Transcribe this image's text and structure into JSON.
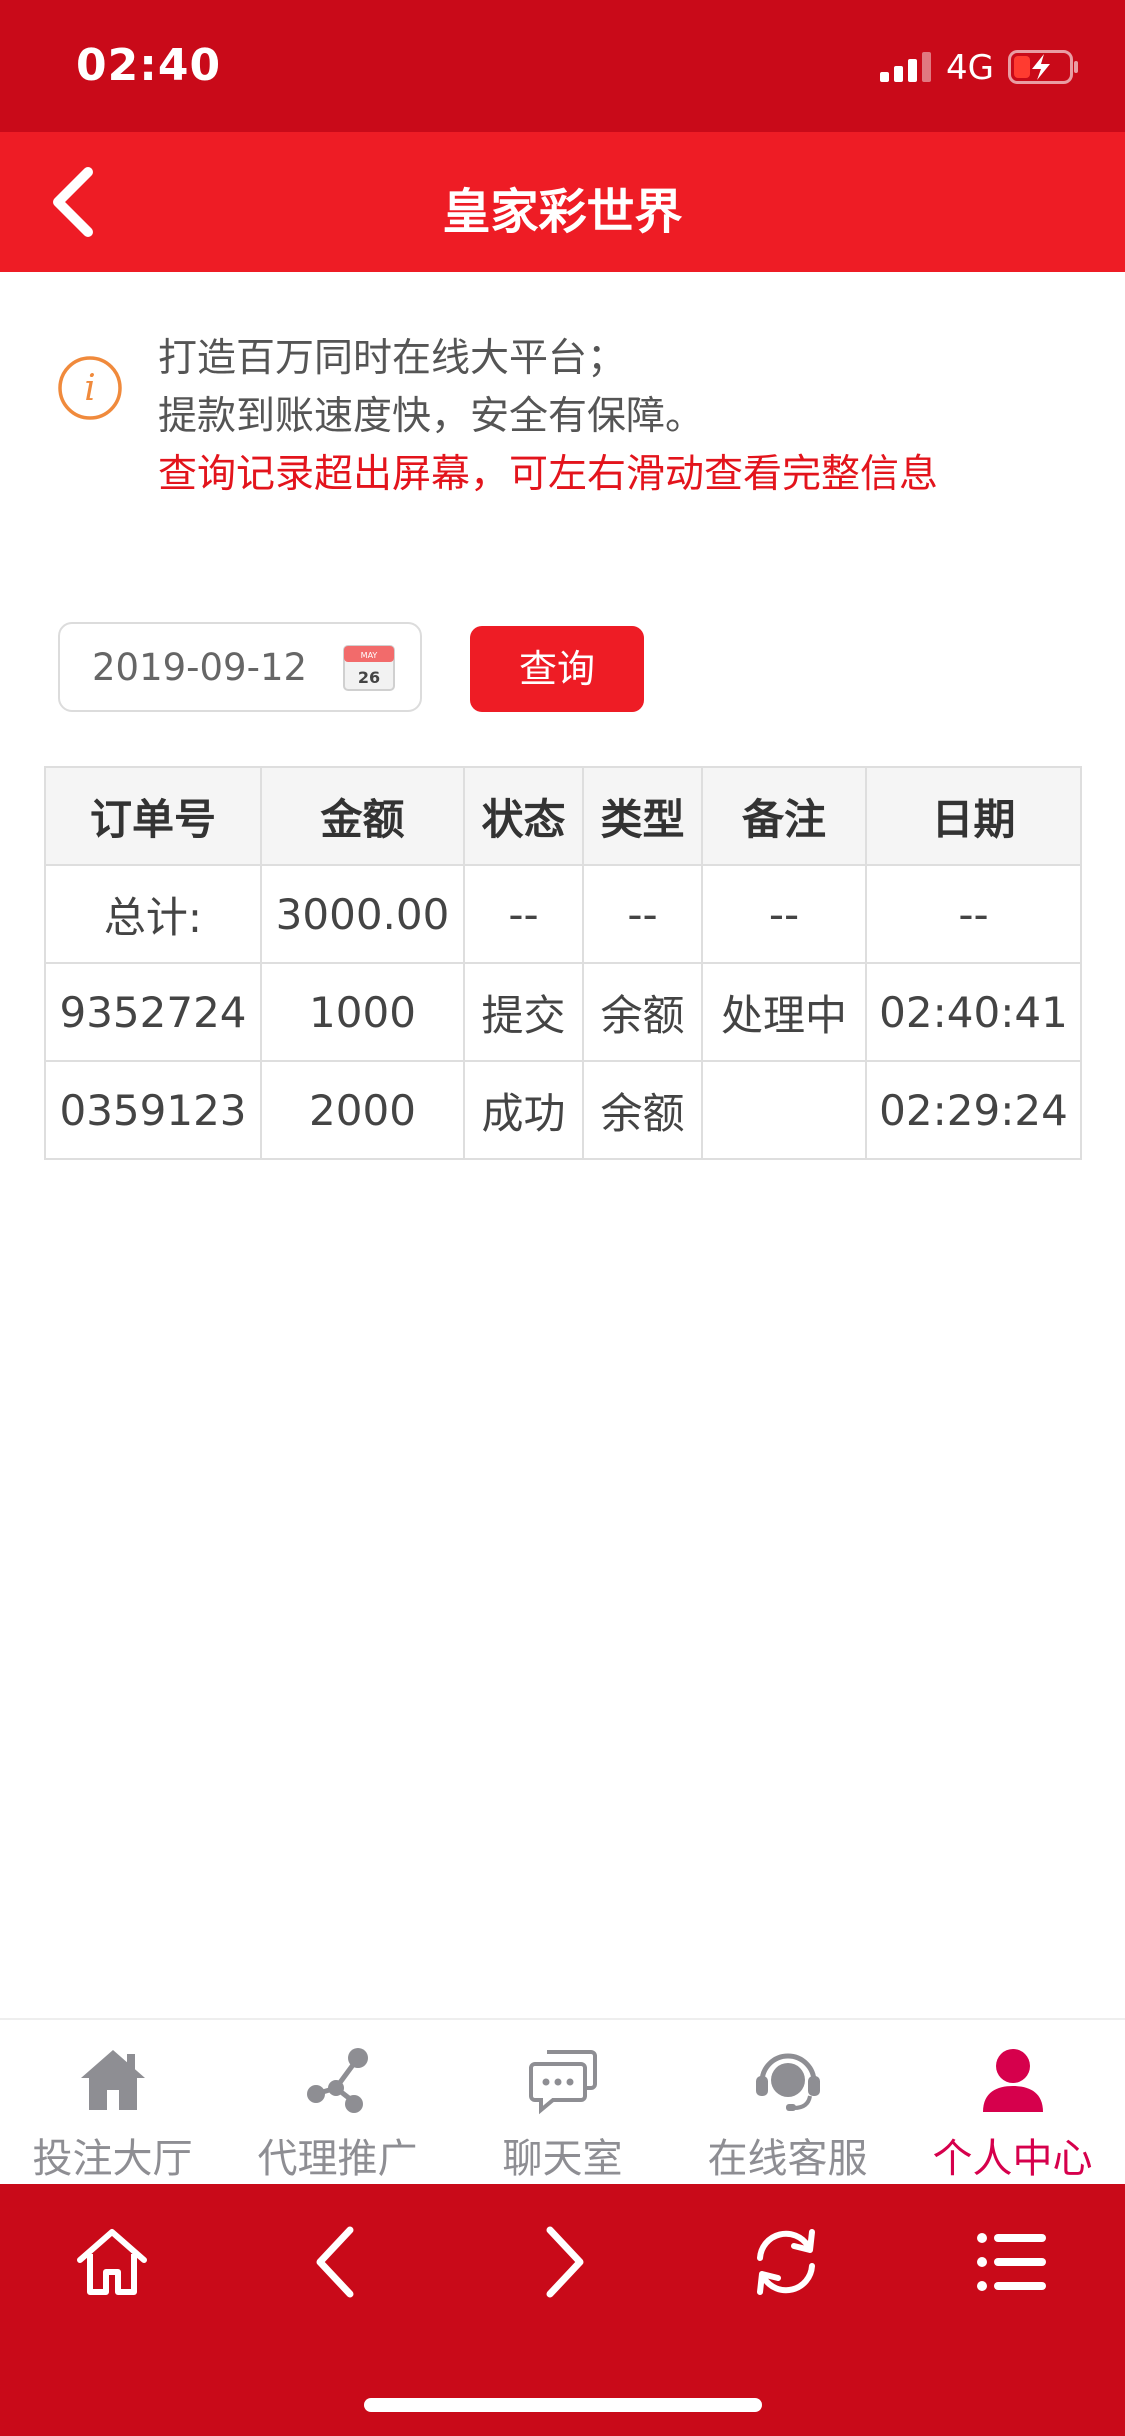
{
  "status_bar": {
    "time": "02:40",
    "network": "4G"
  },
  "header": {
    "title": "皇家彩世界"
  },
  "notice": {
    "lines": [
      "打造百万同时在线大平台；",
      "提款到账速度快，安全有保障。",
      "查询记录超出屏幕，可左右滑动查看完整信息"
    ]
  },
  "query": {
    "date_value": "2019-09-12",
    "calendar_month": "MAY",
    "calendar_day": "26",
    "button_label": "查询"
  },
  "table": {
    "headers": [
      "订单号",
      "金额",
      "状态",
      "类型",
      "备注",
      "日期"
    ],
    "total_row": [
      "总计:",
      "3000.00",
      "--",
      "--",
      "--",
      "--"
    ],
    "rows": [
      [
        "9352724",
        "1000",
        "提交",
        "余额",
        "处理中",
        "02:40:41"
      ],
      [
        "0359123",
        "2000",
        "成功",
        "余额",
        "",
        "02:29:24"
      ]
    ]
  },
  "tabbar": {
    "items": [
      {
        "label": "投注大厅",
        "icon": "home-icon"
      },
      {
        "label": "代理推广",
        "icon": "share-icon"
      },
      {
        "label": "聊天室",
        "icon": "chat-icon"
      },
      {
        "label": "在线客服",
        "icon": "headset-icon"
      },
      {
        "label": "个人中心",
        "icon": "user-icon",
        "active": true
      }
    ]
  },
  "toolbar": {
    "icons": [
      "home-outline-icon",
      "back-arrow-icon",
      "forward-arrow-icon",
      "refresh-icon",
      "menu-icon"
    ]
  },
  "colors": {
    "status_bar": "#c90a19",
    "header": "#ee1c25",
    "accent_red": "#e3141c",
    "active_tab": "#d6004c",
    "inactive_tab": "#8e8e93"
  }
}
